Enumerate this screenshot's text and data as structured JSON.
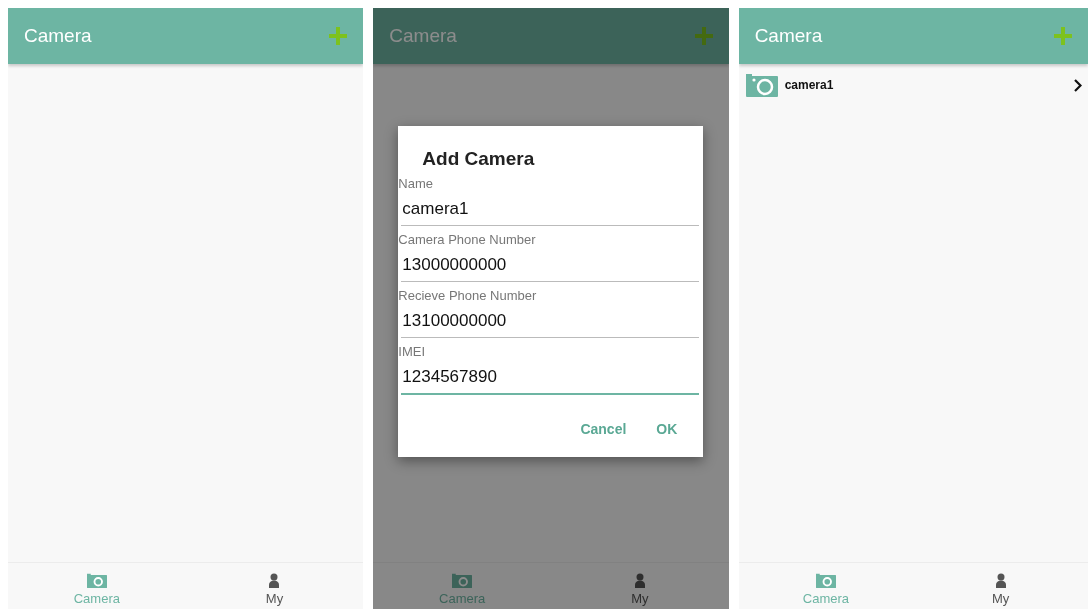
{
  "screens": [
    {
      "title": "Camera",
      "tabs": [
        {
          "label": "Camera",
          "selected": true
        },
        {
          "label": "My",
          "selected": false
        }
      ]
    },
    {
      "title": "Camera",
      "dimmed": true,
      "dialog": {
        "title": "Add Camera",
        "fields": [
          {
            "label": "Name",
            "value": "camera1",
            "focused": false
          },
          {
            "label": "Camera Phone Number",
            "value": "13000000000",
            "focused": false
          },
          {
            "label": "Recieve Phone Number",
            "value": "13100000000",
            "focused": false
          },
          {
            "label": "IMEI",
            "value": "1234567890",
            "focused": true
          }
        ],
        "buttons": [
          "Cancel",
          "OK"
        ]
      },
      "tabs": [
        {
          "label": "Camera",
          "selected": true
        },
        {
          "label": "My",
          "selected": false
        }
      ]
    },
    {
      "title": "Camera",
      "cameras": [
        {
          "name": "camera1"
        }
      ],
      "tabs": [
        {
          "label": "Camera",
          "selected": true
        },
        {
          "label": "My",
          "selected": false
        }
      ]
    }
  ]
}
